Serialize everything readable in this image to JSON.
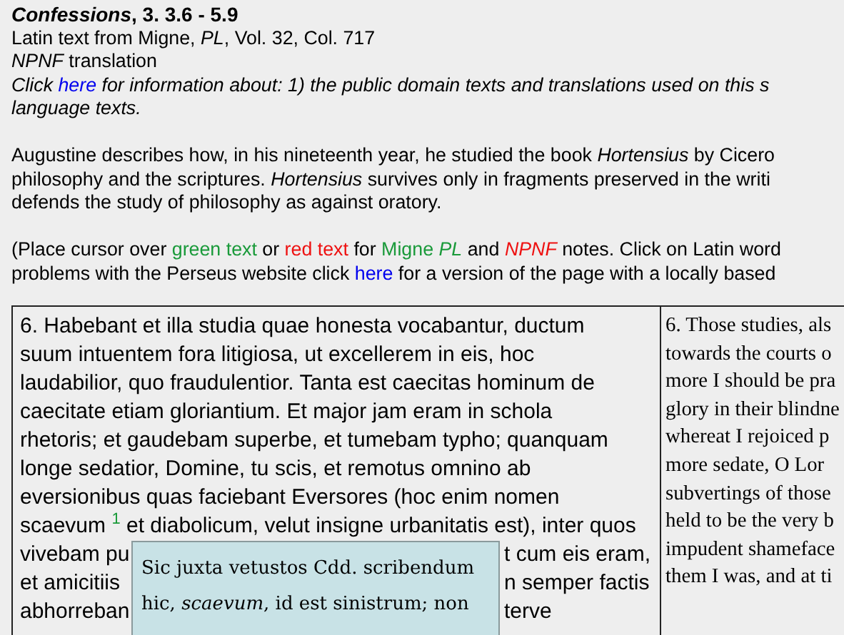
{
  "header": {
    "title": "*Confessions*, 3. 3.6 - 5.9",
    "lines": [
      "Latin text from Migne, *PL*, Vol. 32, Col. 717",
      "*NPNF* translation"
    ]
  },
  "paragraphs": [
    {
      "lines": [
        [
          {
            "kind": "text",
            "text": "Click "
          },
          {
            "kind": "link",
            "text": "here"
          },
          {
            "kind": "text",
            "text": " for information about: 1) the public domain texts and translations used on this s"
          }
        ],
        [
          {
            "kind": "text",
            "text": "language texts."
          }
        ]
      ]
    },
    {
      "lines": [
        [
          {
            "kind": "text",
            "text": "Augustine describes how, in his nineteenth year, he studied the book *Hortensius* by Cicero"
          }
        ],
        [
          {
            "kind": "text",
            "text": "philosophy and the scriptures. *Hortensius* survives only in fragments preserved in the writi"
          }
        ],
        [
          {
            "kind": "text",
            "text": "defends the study of philosophy as against oratory."
          }
        ]
      ]
    },
    {
      "lines": [
        [
          {
            "kind": "text",
            "text": "(Place cursor over "
          },
          {
            "kind": "green",
            "text": "green text"
          },
          {
            "kind": "text",
            "text": " or "
          },
          {
            "kind": "red",
            "text": "red text"
          },
          {
            "kind": "text",
            "text": " for "
          },
          {
            "kind": "green",
            "text": "Migne *PL*"
          },
          {
            "kind": "text",
            "text": " and "
          },
          {
            "kind": "red",
            "text": "*NPNF*"
          },
          {
            "kind": "text",
            "text": " notes. Click on Latin word"
          }
        ],
        [
          {
            "kind": "text",
            "text": "problems with the Perseus website click "
          },
          {
            "kind": "link",
            "text": "here"
          },
          {
            "kind": "text",
            "text": " for a version of the page with a locally based"
          }
        ]
      ]
    }
  ],
  "latin": [
    {
      "covered": false,
      "parts": [
        {
          "kind": "text",
          "text": "6. Habebant et illa studia quae honesta vocabantur, ductum"
        }
      ]
    },
    {
      "covered": false,
      "parts": [
        {
          "kind": "text",
          "text": "suum intuentem fora litigiosa, ut excellerem in eis, hoc"
        }
      ]
    },
    {
      "covered": false,
      "parts": [
        {
          "kind": "text",
          "text": "laudabilior, quo fraudulentior. Tanta est caecitas hominum de"
        }
      ]
    },
    {
      "covered": false,
      "parts": [
        {
          "kind": "text",
          "text": "caecitate etiam gloriantium. Et major jam eram in schola"
        }
      ]
    },
    {
      "covered": false,
      "parts": [
        {
          "kind": "text",
          "text": "rhetoris; et gaudebam superbe, et tumebam typho; quanquam"
        }
      ]
    },
    {
      "covered": false,
      "parts": [
        {
          "kind": "text",
          "text": "longe sedatior, Domine, tu scis, et remotus omnino ab"
        }
      ]
    },
    {
      "covered": false,
      "parts": [
        {
          "kind": "text",
          "text": "eversionibus quas faciebant Eversores (hoc enim nomen"
        }
      ]
    },
    {
      "covered": false,
      "parts": [
        {
          "kind": "text",
          "text": "scaevum "
        },
        {
          "kind": "note_mark",
          "text": "1"
        },
        {
          "kind": "text",
          "text": " et diabolicum, velut insigne urbanitatis est), inter quos"
        }
      ]
    },
    {
      "covered": true,
      "parts": [
        {
          "kind": "text",
          "text": "vivebam pu"
        },
        {
          "kind": "text",
          "text": "t cum eis eram,"
        }
      ]
    },
    {
      "covered": true,
      "parts": [
        {
          "kind": "text",
          "text": "et amicitiis"
        },
        {
          "kind": "text",
          "text": "n semper factis"
        }
      ]
    },
    {
      "covered": true,
      "parts": [
        {
          "kind": "text",
          "text": "abhorreban"
        },
        {
          "kind": "text",
          "text": "terve"
        }
      ]
    }
  ],
  "translation": [
    "6. Those studies, als",
    "towards the courts o",
    "more I should be pra",
    "glory in their blindne",
    "whereat I rejoiced p",
    "more sedate, O Lor",
    "subvertings of those",
    "held to be the very b",
    "impudent shameface",
    "them I was, and at ti"
  ],
  "tooltip": {
    "lines": [
      "Sic juxta vetustos Cdd. scribendum",
      "hic, *scaevum*, id est sinistrum; non"
    ]
  }
}
